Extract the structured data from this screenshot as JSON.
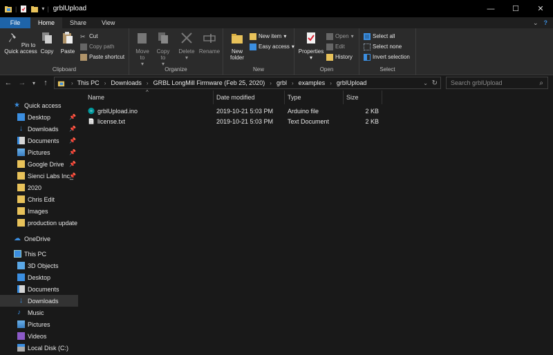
{
  "window": {
    "title": "grblUpload",
    "controls": {
      "minimize": "—",
      "maximize": "☐",
      "close": "✕"
    }
  },
  "ribbon_tabs": [
    "File",
    "Home",
    "Share",
    "View"
  ],
  "ribbon": {
    "clipboard": {
      "label": "Clipboard",
      "pin": "Pin to Quick access",
      "copy": "Copy",
      "paste": "Paste",
      "cut": "Cut",
      "copy_path": "Copy path",
      "paste_shortcut": "Paste shortcut"
    },
    "organize": {
      "label": "Organize",
      "move_to": "Move to",
      "copy_to": "Copy to",
      "delete": "Delete",
      "rename": "Rename"
    },
    "new": {
      "label": "New",
      "new_folder": "New folder",
      "new_item": "New item",
      "easy_access": "Easy access"
    },
    "open": {
      "label": "Open",
      "properties": "Properties",
      "open": "Open",
      "edit": "Edit",
      "history": "History"
    },
    "select": {
      "label": "Select",
      "select_all": "Select all",
      "select_none": "Select none",
      "invert": "Invert selection"
    }
  },
  "address": {
    "breadcrumbs": [
      "This PC",
      "Downloads",
      "GRBL LongMill Firmware (Feb 25, 2020)",
      "grbl",
      "examples",
      "grblUpload"
    ]
  },
  "search": {
    "placeholder": "Search grblUpload"
  },
  "sidebar": {
    "quick_access": {
      "label": "Quick access",
      "items": [
        {
          "label": "Desktop",
          "icon": "desktop-icon",
          "pinned": true
        },
        {
          "label": "Downloads",
          "icon": "downloads-icon",
          "pinned": true
        },
        {
          "label": "Documents",
          "icon": "documents-icon",
          "pinned": true
        },
        {
          "label": "Pictures",
          "icon": "pictures-icon",
          "pinned": true
        },
        {
          "label": "Google Drive",
          "icon": "folder-icon",
          "pinned": true
        },
        {
          "label": "Sienci Labs Inc_",
          "icon": "folder-icon",
          "pinned": true
        },
        {
          "label": "2020",
          "icon": "folder-icon",
          "pinned": false
        },
        {
          "label": "Chris Edit",
          "icon": "folder-icon",
          "pinned": false
        },
        {
          "label": "Images",
          "icon": "folder-icon",
          "pinned": false
        },
        {
          "label": "production update",
          "icon": "folder-icon",
          "pinned": false
        }
      ]
    },
    "onedrive": "OneDrive",
    "this_pc": {
      "label": "This PC",
      "items": [
        "3D Objects",
        "Desktop",
        "Documents",
        "Downloads",
        "Music",
        "Pictures",
        "Videos",
        "Local Disk (C:)"
      ],
      "selected": "Downloads"
    }
  },
  "columns": [
    "Name",
    "Date modified",
    "Type",
    "Size"
  ],
  "files": [
    {
      "name": "grblUpload.ino",
      "date": "2019-10-21 5:03 PM",
      "type": "Arduino file",
      "size": "2 KB",
      "icon": "arduino-file-icon"
    },
    {
      "name": "license.txt",
      "date": "2019-10-21 5:03 PM",
      "type": "Text Document",
      "size": "2 KB",
      "icon": "text-file-icon"
    }
  ],
  "colors": {
    "file_tab": "#1e64a9",
    "folder": "#e8c25a",
    "accent_blue": "#3b8ee0",
    "background": "#191919"
  }
}
